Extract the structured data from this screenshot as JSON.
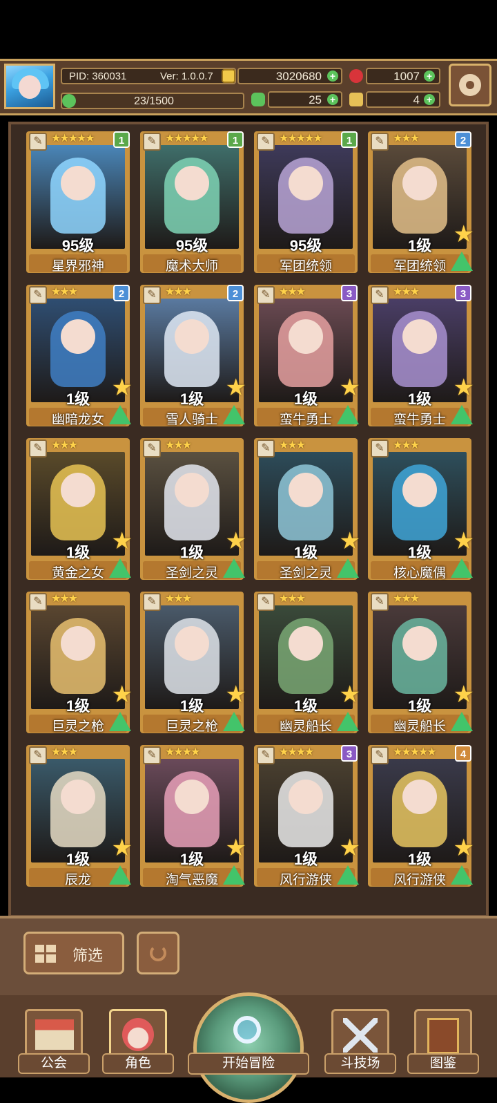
{
  "header": {
    "pid": "PID: 360031",
    "version": "Ver: 1.0.0.7",
    "gold": "3020680",
    "gems": "1007",
    "stamina": "23/1500",
    "clover": "25",
    "keys": "4"
  },
  "cards": [
    {
      "name": "星界邪神",
      "level": "95级",
      "stars": "★★★★★",
      "rank": "1",
      "rank_color": "#5aa84a",
      "art": "#4a86b8",
      "fig": "#8fd6ff",
      "upgradable": false
    },
    {
      "name": "魔术大师",
      "level": "95级",
      "stars": "★★★★★",
      "rank": "1",
      "rank_color": "#5aa84a",
      "art": "#3f6e6a",
      "fig": "#7fd3b5",
      "upgradable": false
    },
    {
      "name": "军团统领",
      "level": "95级",
      "stars": "★★★★★",
      "rank": "1",
      "rank_color": "#5aa84a",
      "art": "#3e3a5a",
      "fig": "#b9a4d6",
      "upgradable": false
    },
    {
      "name": "军团统领",
      "level": "1级",
      "stars": "★★★",
      "rank": "2",
      "rank_color": "#4c8fd6",
      "art": "#5a4a3a",
      "fig": "#e3c08a",
      "upgradable": true
    },
    {
      "name": "幽暗龙女",
      "level": "1级",
      "stars": "★★★",
      "rank": "2",
      "rank_color": "#4c8fd6",
      "art": "#2f4e72",
      "fig": "#3f7fc4",
      "upgradable": true
    },
    {
      "name": "雪人骑士",
      "level": "1级",
      "stars": "★★★",
      "rank": "2",
      "rank_color": "#4c8fd6",
      "art": "#5a7aa0",
      "fig": "#dfe9f5",
      "upgradable": true
    },
    {
      "name": "蛮牛勇士",
      "level": "1级",
      "stars": "★★★",
      "rank": "3",
      "rank_color": "#8a5ac4",
      "art": "#6a4a52",
      "fig": "#e5a0a0",
      "upgradable": true
    },
    {
      "name": "蛮牛勇士",
      "level": "1级",
      "stars": "★★★",
      "rank": "3",
      "rank_color": "#8a5ac4",
      "art": "#4a3e66",
      "fig": "#a890d0",
      "upgradable": true
    },
    {
      "name": "黄金之女",
      "level": "1级",
      "stars": "★★★",
      "rank": "",
      "rank_color": "",
      "art": "#5a4a2a",
      "fig": "#e8c354",
      "upgradable": true
    },
    {
      "name": "圣剑之灵",
      "level": "1级",
      "stars": "★★★",
      "rank": "",
      "rank_color": "",
      "art": "#5a5040",
      "fig": "#e4e8f0",
      "upgradable": true
    },
    {
      "name": "圣剑之灵",
      "level": "1级",
      "stars": "★★★",
      "rank": "",
      "rank_color": "",
      "art": "#2d4c5a",
      "fig": "#8fc7d8",
      "upgradable": true
    },
    {
      "name": "核心魔偶",
      "level": "1级",
      "stars": "★★★",
      "rank": "",
      "rank_color": "",
      "art": "#2e4f5c",
      "fig": "#3fa6d8",
      "upgradable": true
    },
    {
      "name": "巨灵之枪",
      "level": "1级",
      "stars": "★★★",
      "rank": "",
      "rank_color": "",
      "art": "#5a4630",
      "fig": "#e8c070",
      "upgradable": true
    },
    {
      "name": "巨灵之枪",
      "level": "1级",
      "stars": "★★★",
      "rank": "",
      "rank_color": "",
      "art": "#4a5a6a",
      "fig": "#dfe4ea",
      "upgradable": true
    },
    {
      "name": "幽灵船长",
      "level": "1级",
      "stars": "★★★",
      "rank": "",
      "rank_color": "",
      "art": "#3a4a3a",
      "fig": "#7aa874",
      "upgradable": true
    },
    {
      "name": "幽灵船长",
      "level": "1级",
      "stars": "★★★",
      "rank": "",
      "rank_color": "",
      "art": "#4a3a3a",
      "fig": "#6ab6a0",
      "upgradable": true
    },
    {
      "name": "辰龙",
      "level": "1级",
      "stars": "★★★",
      "rank": "",
      "rank_color": "",
      "art": "#3a5a6a",
      "fig": "#e6dcc4",
      "upgradable": true
    },
    {
      "name": "淘气恶魔",
      "level": "1级",
      "stars": "★★★★",
      "rank": "",
      "rank_color": "",
      "art": "#6a4a5a",
      "fig": "#e7a0b8",
      "upgradable": true
    },
    {
      "name": "风行游侠",
      "level": "1级",
      "stars": "★★★★",
      "rank": "3",
      "rank_color": "#8a5ac4",
      "art": "#4a4030",
      "fig": "#eaeaea",
      "upgradable": true
    },
    {
      "name": "风行游侠",
      "level": "1级",
      "stars": "★★★★★",
      "rank": "4",
      "rank_color": "#d08a3a",
      "art": "#3a3a4a",
      "fig": "#e8c560",
      "upgradable": true
    }
  ],
  "filter": {
    "label": "筛选"
  },
  "nav": {
    "guild": "公会",
    "character": "角色",
    "adventure": "开始冒险",
    "arena": "斗技场",
    "codex": "图鉴"
  },
  "colors": {
    "frame": "#c9933f",
    "panel": "#3a2b22",
    "accent_green": "#5cc35c",
    "star": "#ffd24a"
  }
}
